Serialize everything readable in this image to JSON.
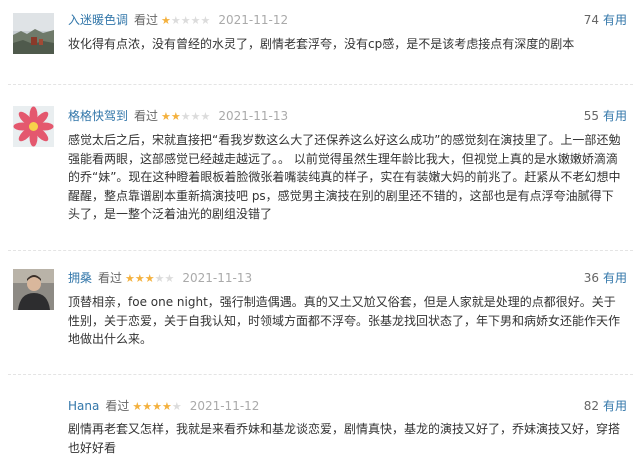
{
  "reviews": [
    {
      "author": "入迷暖色调",
      "watched": "看过",
      "rating": 1,
      "date": "2021-11-12",
      "vote_count": "74",
      "vote_label": "有用",
      "content": "妆化得有点浓，没有曾经的水灵了，剧情老套浮夸，没有cp感，是不是该考虑接点有深度的剧本"
    },
    {
      "author": "格格快驾到",
      "watched": "看过",
      "rating": 2,
      "date": "2021-11-13",
      "vote_count": "55",
      "vote_label": "有用",
      "content": "感觉太后之后，宋就直接把“看我岁数这么大了还保养这么好这么成功”的感觉刻在演技里了。上一部还勉强能看两眼，这部感觉已经越走越远了。。 以前觉得虽然生理年龄比我大，但视觉上真的是水嫩嫩娇滴滴的乔“妹”。现在这种瞪着眼板着脸微张着嘴装纯真的样子，实在有装嫩大妈的前兆了。赶紧从不老幻想中醒醒，整点靠谱剧本重新搞演技吧 ps，感觉男主演技在别的剧里还不错的，这部也是有点浮夸油腻得下头了，是一整个泛着油光的剧组没错了"
    },
    {
      "author": "拥桑",
      "watched": "看过",
      "rating": 3,
      "date": "2021-11-13",
      "vote_count": "36",
      "vote_label": "有用",
      "content": "顶替相亲，foe one night，强行制造偶遇。真的又土又尬又俗套，但是人家就是处理的点都很好。关于性别，关于恋爱，关于自我认知，时领域方面都不浮夸。张基龙找回状态了，年下男和病娇女还能作天作地做出什么来。"
    },
    {
      "author": "Hana",
      "watched": "看过",
      "rating": 4,
      "date": "2021-11-12",
      "vote_count": "82",
      "vote_label": "有用",
      "content": "剧情再老套又怎样，我就是来看乔妹和基龙谈恋爱，剧情真快，基龙的演技又好了，乔妹演技又好，穿搭也好好看"
    }
  ]
}
